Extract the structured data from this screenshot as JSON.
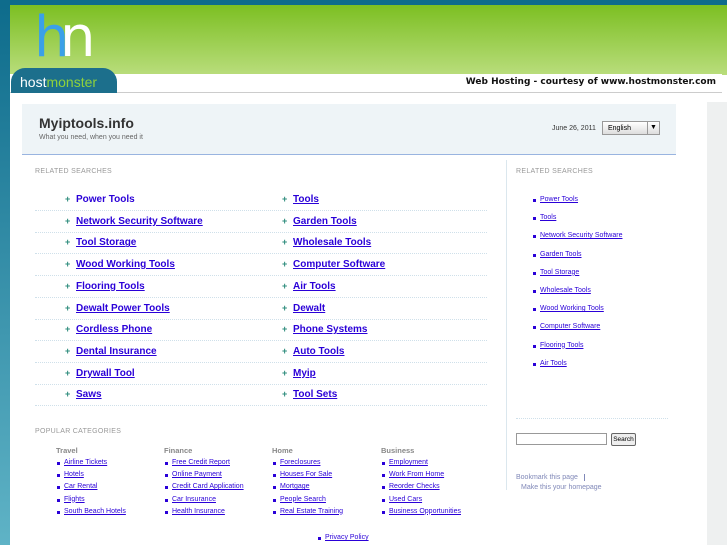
{
  "header": {
    "logo_h": "h",
    "logo_m": "n",
    "logo_host": "host",
    "logo_monster": "monster",
    "courtesy": "Web Hosting - courtesy of www.hostmonster.com"
  },
  "site": {
    "title": "Myiptools.info",
    "tagline": "What you need, when you need it",
    "date": "June 26, 2011",
    "language": "English"
  },
  "related_label": "RELATED SEARCHES",
  "related": [
    [
      "Power Tools",
      "Tools"
    ],
    [
      "Network Security Software",
      "Garden Tools"
    ],
    [
      "Tool Storage",
      "Wholesale Tools"
    ],
    [
      "Wood Working Tools",
      "Computer Software"
    ],
    [
      "Flooring Tools",
      "Air Tools"
    ],
    [
      "Dewalt Power Tools",
      "Dewalt"
    ],
    [
      "Cordless Phone",
      "Phone Systems"
    ],
    [
      "Dental Insurance",
      "Auto Tools"
    ],
    [
      "Drywall Tool",
      "Myip"
    ],
    [
      "Saws",
      "Tool Sets"
    ]
  ],
  "sidebar_label": "RELATED SEARCHES",
  "sidebar": [
    "Power Tools",
    "Tools",
    "Network Security Software",
    "Garden Tools",
    "Tool Storage",
    "Wholesale Tools",
    "Wood Working Tools",
    "Computer Software",
    "Flooring Tools",
    "Air Tools"
  ],
  "popular_label": "POPULAR CATEGORIES",
  "categories": [
    {
      "name": "Travel",
      "links": [
        "Airline Tickets",
        "Hotels",
        "Car Rental",
        "Flights",
        "South Beach Hotels"
      ]
    },
    {
      "name": "Finance",
      "links": [
        "Free Credit Report",
        "Online Payment",
        "Credit Card Application",
        "Car Insurance",
        "Health Insurance"
      ]
    },
    {
      "name": "Home",
      "links": [
        "Foreclosures",
        "Houses For Sale",
        "Mortgage",
        "People Search",
        "Real Estate Training"
      ]
    },
    {
      "name": "Business",
      "links": [
        "Employment",
        "Work From Home",
        "Reorder Checks",
        "Used Cars",
        "Business Opportunities"
      ]
    }
  ],
  "search_button": "Search",
  "bookmark": "Bookmark this page",
  "homepage": "Make this your homepage",
  "privacy": "Privacy Policy"
}
